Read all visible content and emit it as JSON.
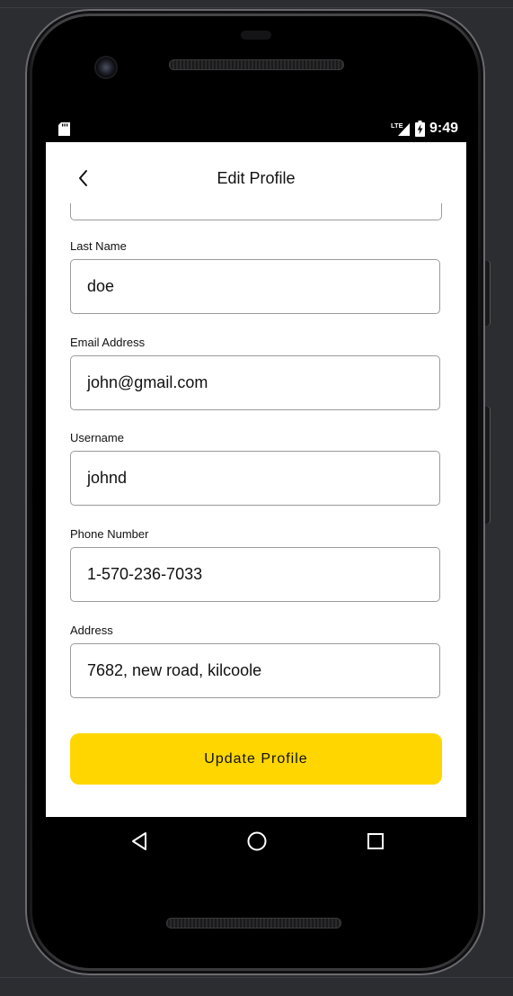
{
  "status_bar": {
    "network": "LTE",
    "time": "9:49"
  },
  "header": {
    "title": "Edit Profile"
  },
  "form": {
    "fields": [
      {
        "label": "Last Name",
        "value": "doe"
      },
      {
        "label": "Email Address",
        "value": "john@gmail.com"
      },
      {
        "label": "Username",
        "value": "johnd"
      },
      {
        "label": "Phone Number",
        "value": "1-570-236-7033"
      },
      {
        "label": "Address",
        "value": "7682, new road, kilcoole"
      }
    ],
    "submit_label": "Update Profile"
  },
  "colors": {
    "accent": "#ffd600",
    "border": "#9a9a9a",
    "background": "#ffffff"
  },
  "icons": {
    "back": "chevron-left-icon",
    "nav_back": "triangle-back-icon",
    "nav_home": "circle-home-icon",
    "nav_recent": "square-recent-icon",
    "sd_card": "sd-card-icon",
    "signal": "signal-icon",
    "battery": "battery-charging-icon"
  }
}
